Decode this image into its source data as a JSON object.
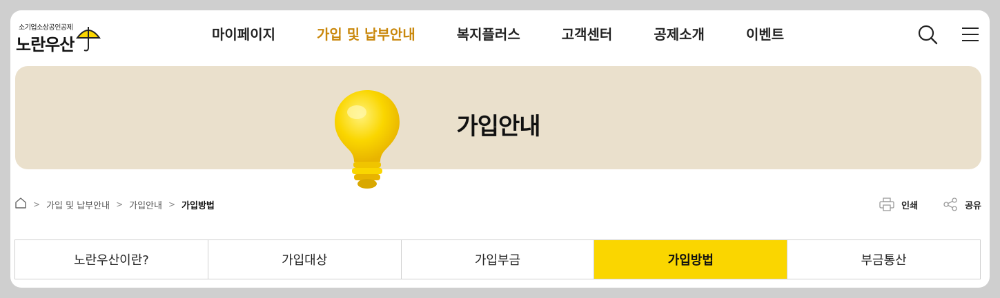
{
  "header": {
    "logo_sub": "소기업소상공인공제",
    "logo_main": "노란우산",
    "nav": [
      {
        "label": "마이페이지",
        "active": false
      },
      {
        "label": "가입 및 납부안내",
        "active": true
      },
      {
        "label": "복지플러스",
        "active": false
      },
      {
        "label": "고객센터",
        "active": false
      },
      {
        "label": "공제소개",
        "active": false
      },
      {
        "label": "이벤트",
        "active": false
      }
    ],
    "search_icon": "search-icon",
    "menu_icon": "hamburger-menu-icon"
  },
  "banner": {
    "title": "가입안내",
    "illustration": "lightbulb-icon"
  },
  "breadcrumb": {
    "home_icon": "home-icon",
    "items": [
      "가입 및 납부안내",
      "가입안내",
      "가입방법"
    ]
  },
  "tools": {
    "print_label": "인쇄",
    "share_label": "공유",
    "print_icon": "printer-icon",
    "share_icon": "share-icon"
  },
  "tabs": [
    {
      "label": "노란우산이란?",
      "active": false
    },
    {
      "label": "가입대상",
      "active": false
    },
    {
      "label": "가입부금",
      "active": false
    },
    {
      "label": "가입방법",
      "active": true
    },
    {
      "label": "부금통산",
      "active": false
    }
  ],
  "colors": {
    "accent": "#fad600",
    "nav_active": "#c9870a",
    "banner_bg": "#eae0cc"
  }
}
